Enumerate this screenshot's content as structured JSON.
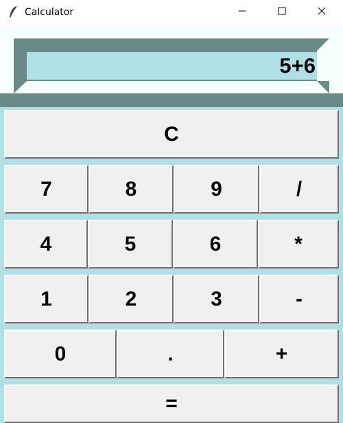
{
  "window": {
    "title": "Calculator",
    "controls": {
      "minimize_icon": "minimize-icon",
      "maximize_icon": "maximize-icon",
      "close_icon": "close-icon"
    }
  },
  "display": {
    "value": "5+6"
  },
  "keypad": {
    "clear": "C",
    "row1": [
      "7",
      "8",
      "9",
      "/"
    ],
    "row2": [
      "4",
      "5",
      "6",
      "*"
    ],
    "row3": [
      "1",
      "2",
      "3",
      "-"
    ],
    "row4": [
      "0",
      ".",
      "+"
    ],
    "equals": "="
  },
  "colors": {
    "background": "#b0e0e6",
    "frame": "#6a8a8a",
    "button": "#f0f0f0"
  }
}
